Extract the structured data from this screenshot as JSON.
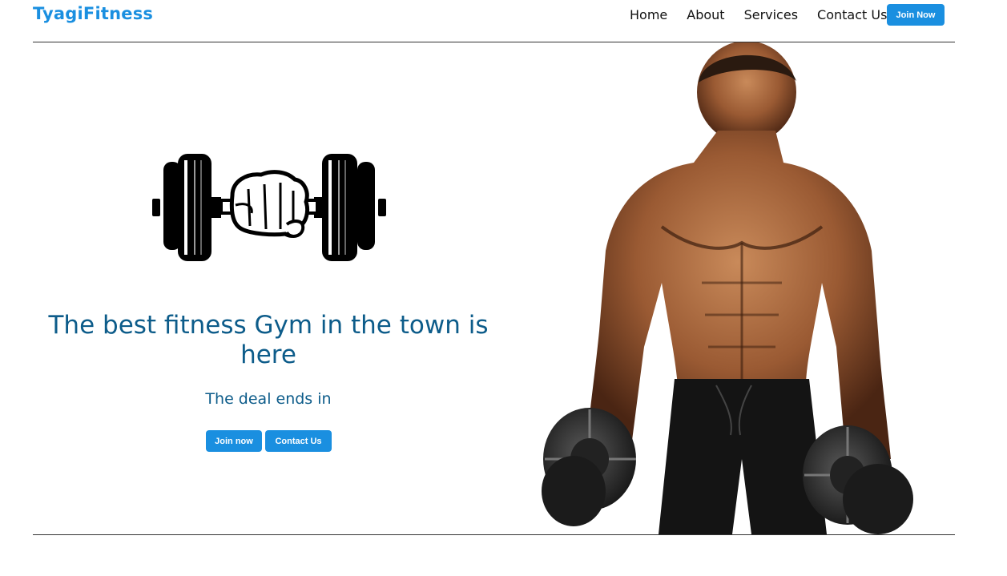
{
  "header": {
    "brand": "TyagiFitness",
    "nav": [
      {
        "label": "Home"
      },
      {
        "label": "About"
      },
      {
        "label": "Services"
      },
      {
        "label": "Contact Us"
      }
    ],
    "join_button": "Join Now"
  },
  "hero": {
    "headline": "The best fitness Gym in the town is here",
    "subhead": "The deal ends in",
    "join_button": "Join now",
    "contact_button": "Contact Us",
    "logo_icon": "dumbbell-fist-icon",
    "image_icon": "bodybuilder-with-dumbbells-image"
  },
  "colors": {
    "brand": "#1a8fe0",
    "button": "#1a8fe0",
    "headline": "#0d5c8a",
    "rule": "#333333",
    "skin": "#9a5a33",
    "shorts": "#141414"
  }
}
